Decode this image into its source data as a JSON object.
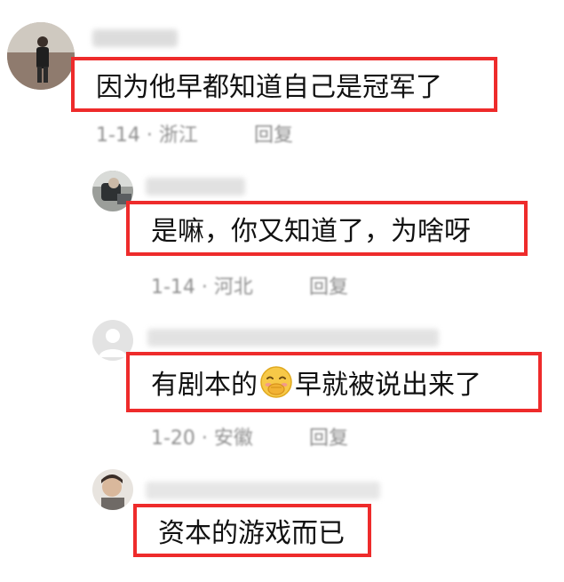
{
  "comments": [
    {
      "text": "因为他早都知道自己是冠军了",
      "meta": "1-14 · 浙江",
      "reply": "回复"
    },
    {
      "text": "是嘛，你又知道了，为啥呀",
      "meta": "1-14 · 河北",
      "reply": "回复"
    },
    {
      "text_before": "有剧本的",
      "emoji": "covering-mouth-smile-emoji",
      "text_after": "早就被说出来了",
      "meta": "1-20 · 安徽",
      "reply": "回复"
    },
    {
      "text": "资本的游戏而已"
    }
  ],
  "colors": {
    "highlight_border": "#ee2b2b",
    "meta_text": "#8f8f8f"
  }
}
